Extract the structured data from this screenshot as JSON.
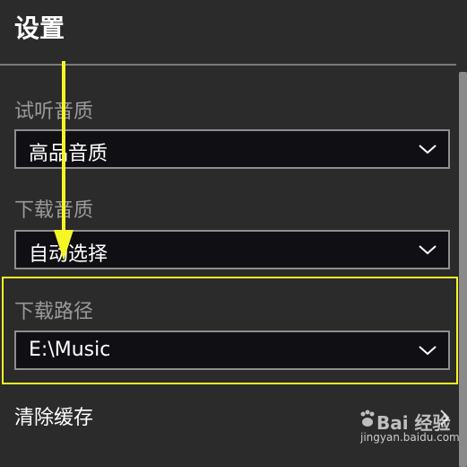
{
  "window": {
    "title": "设置"
  },
  "settings": {
    "preview_quality": {
      "label": "试听音质",
      "value": "高品音质"
    },
    "download_quality": {
      "label": "下载音质",
      "value": "自动选择"
    },
    "download_path": {
      "label": "下载路径",
      "value": "E:\\Music"
    },
    "clear_cache": {
      "label": "清除缓存"
    }
  },
  "annotations": {
    "arrow_color": "#f6f626",
    "highlight_color": "#f6f626"
  },
  "watermark": {
    "text": "Bai 经验",
    "subtext": "jingyan.baidu.com"
  },
  "icons": {
    "dropdown": "chevron-down-icon",
    "navigate": "chevron-right-icon"
  }
}
